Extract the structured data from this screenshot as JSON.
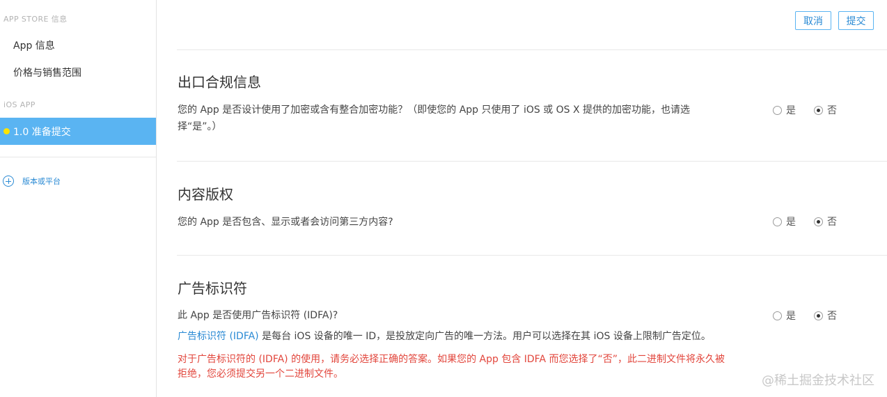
{
  "sidebar": {
    "heading_store": "APP STORE 信息",
    "item_app_info": "App 信息",
    "item_pricing": "价格与销售范围",
    "heading_ios": "iOS APP",
    "active_item": "1.0 准备提交",
    "add_label": "版本或平台"
  },
  "toolbar": {
    "cancel_label": "取消",
    "submit_label": "提交"
  },
  "sections": {
    "export": {
      "title": "出口合规信息",
      "question_line1": "您的 App 是否设计使用了加密或含有整合加密功能？（即使您的 App 只使用了 iOS 或 OS X 提供的加密功能，也请选",
      "question_line2": "择“是”。）",
      "yes_label": "是",
      "no_label": "否",
      "selected": "否"
    },
    "content": {
      "title": "内容版权",
      "question": "您的 App 是否包含、显示或者会访问第三方内容?",
      "yes_label": "是",
      "no_label": "否",
      "selected": "否"
    },
    "idfa": {
      "title": "广告标识符",
      "question": "此 App 是否使用广告标识符 (IDFA)?",
      "note_link": "广告标识符 (IDFA)",
      "note_text": " 是每台 iOS 设备的唯一 ID，是投放定向广告的唯一方法。用户可以选择在其 iOS 设备上限制广告定位。",
      "warning_line1": "对于广告标识符的 (IDFA) 的使用，请务必选择正确的答案。如果您的 App 包含 IDFA 而您选择了“否”，此二进制文件将永久被",
      "warning_line2": "拒绝，您必须提交另一个二进制文件。",
      "yes_label": "是",
      "no_label": "否",
      "selected": "否"
    }
  },
  "watermark": "@稀土掘金技术社区",
  "colors": {
    "accent": "#2a8ad4",
    "active_bg": "#5ab4f2",
    "warning": "#e2463c",
    "status_dot": "#ffe400"
  }
}
